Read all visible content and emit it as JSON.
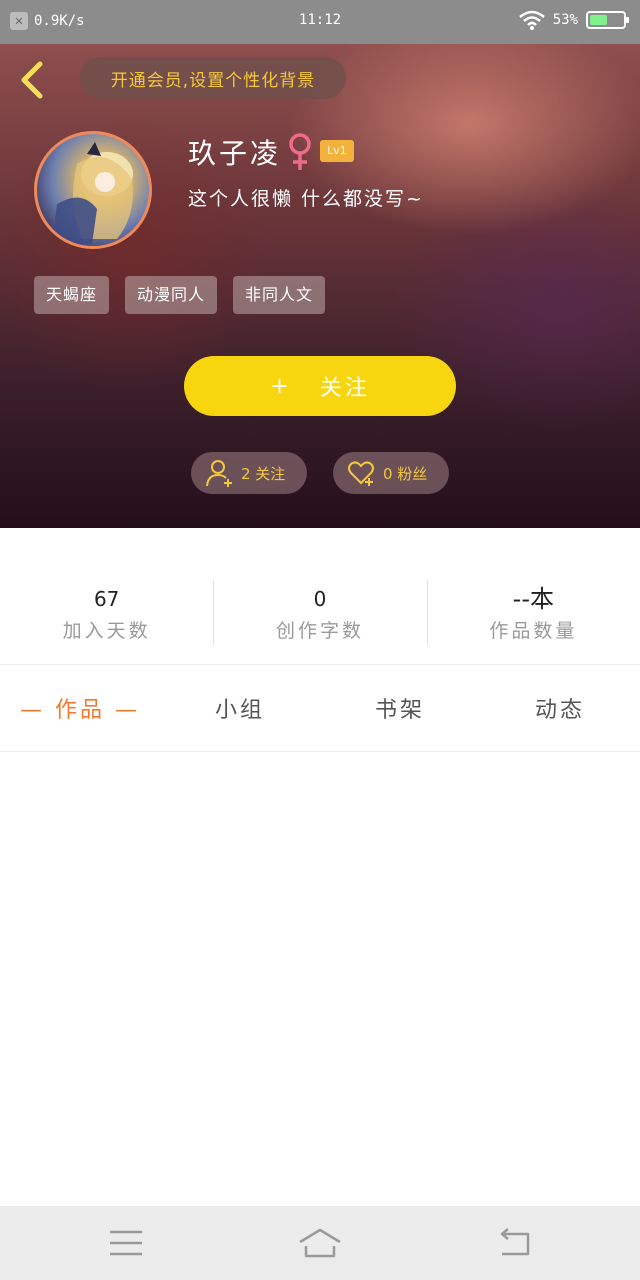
{
  "status_bar": {
    "network_speed": "0.9K/s",
    "time": "11:12",
    "battery_percent": "53%",
    "battery_level": 0.53
  },
  "header": {
    "vip_prompt": "开通会员,设置个性化背景",
    "username": "玖子凌",
    "gender_symbol": "♀",
    "level": "Lv1",
    "bio": "这个人很懒 什么都没写~",
    "tags": [
      "天蝎座",
      "动漫同人",
      "非同人文"
    ],
    "follow_button": {
      "icon": "+",
      "label": "关注"
    },
    "following": "2 关注",
    "fans": "0 粉丝"
  },
  "stats": [
    {
      "value": "67",
      "label": "加入天数"
    },
    {
      "value": "0",
      "label": "创作字数"
    },
    {
      "value": "--本",
      "label": "作品数量"
    }
  ],
  "tabs": [
    {
      "label": "— 作品 —",
      "active": true
    },
    {
      "label": "小组",
      "active": false
    },
    {
      "label": "书架",
      "active": false
    },
    {
      "label": "动态",
      "active": false
    }
  ],
  "colors": {
    "accent_yellow": "#f7d60f",
    "tab_active": "#f07a2f",
    "gold_text": "#f5c83c",
    "gender_pink": "#f06a8a"
  }
}
